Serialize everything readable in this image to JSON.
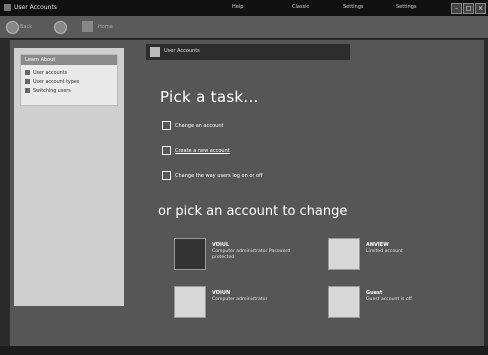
{
  "window": {
    "title": "User Accounts"
  },
  "titlebar_links": [
    "Help",
    "Classic",
    "Settings",
    "Settings"
  ],
  "toolbar": {
    "back_label": "Back",
    "forward_label": "",
    "home_label": "Home"
  },
  "sidebar": {
    "heading": "Learn About",
    "items": [
      "User accounts",
      "User account types",
      "Switching users"
    ]
  },
  "header": {
    "title": "User Accounts"
  },
  "main": {
    "pick_title": "Pick a task...",
    "tasks": [
      "Change an account",
      "Create a new account",
      "Change the way users log on or off"
    ],
    "pick_account_title": "or pick an account to change",
    "accounts": [
      {
        "name": "VOIUL",
        "desc": "Computer administrator Password protected"
      },
      {
        "name": "ANVIEW",
        "desc": "Limited account"
      },
      {
        "name": "VOIUN",
        "desc": "Computer administrator"
      },
      {
        "name": "Guest",
        "desc": "Guest account is off"
      }
    ]
  },
  "icons": {
    "title_icon": "user-accounts-icon",
    "back": "back-arrow-icon",
    "forward": "forward-arrow-icon",
    "home": "home-icon",
    "task_arrow": "arrow-icon"
  }
}
